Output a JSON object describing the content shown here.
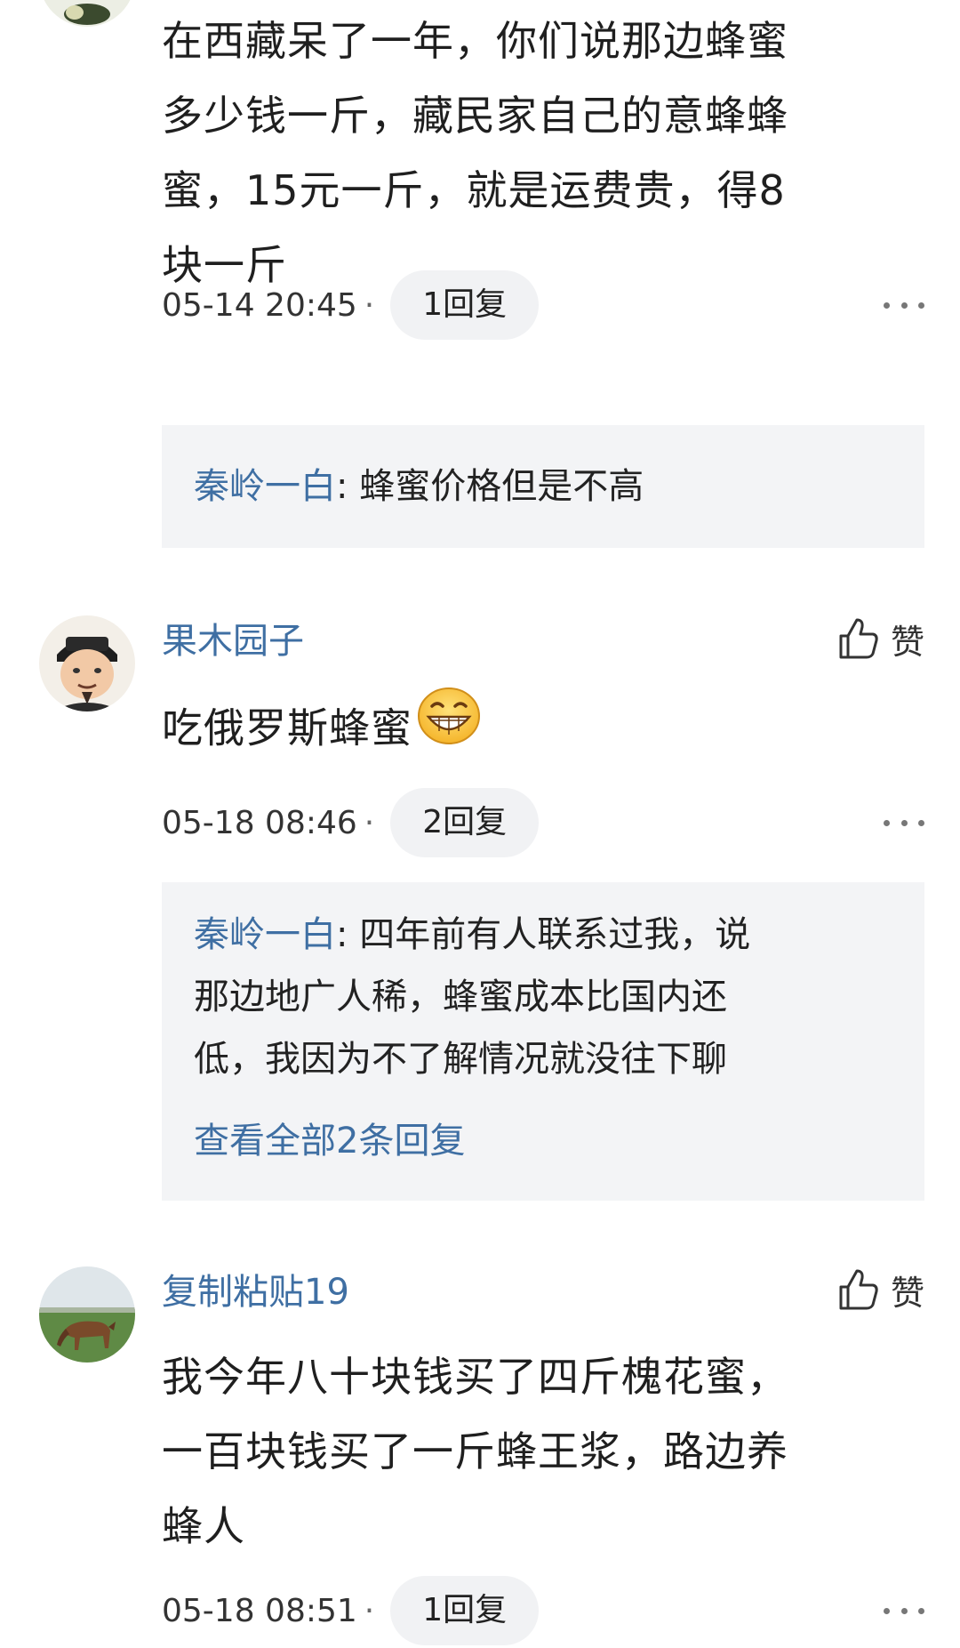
{
  "comments": [
    {
      "content_lines": [
        "在西藏呆了一年，你们说那边蜂蜜",
        "多少钱一斤，藏民家自己的意蜂蜂",
        "蜜，15元一斤，就是运费贵，得8",
        "块一斤"
      ],
      "time": "05-14 20:45",
      "dot": "·",
      "reply_count": "1回复",
      "replies": [
        {
          "user": "秦岭一白",
          "sep": ": ",
          "text": "蜂蜜价格但是不高"
        }
      ]
    },
    {
      "user": "果木园子",
      "like_label": "赞",
      "content": "吃俄罗斯蜂蜜",
      "emoji": "grinning-face-icon",
      "time": "05-18 08:46",
      "dot": "·",
      "reply_count": "2回复",
      "replies": [
        {
          "user": "秦岭一白",
          "sep": ": ",
          "text_lines": [
            "四年前有人联系过我，说",
            "那边地广人稀，蜂蜜成本比国内还",
            "低，我因为不了解情况就没往下聊"
          ]
        }
      ],
      "view_all": "查看全部2条回复"
    },
    {
      "user": "复制粘贴19",
      "like_label": "赞",
      "content_lines": [
        "我今年八十块钱买了四斤槐花蜜，",
        "一百块钱买了一斤蜂王浆，路边养",
        "蜂人"
      ],
      "time": "05-18 08:51",
      "dot": "·",
      "reply_count": "1回复"
    }
  ],
  "colors": {
    "username": "#3f6fa3",
    "reply_bg": "#f3f4f6",
    "pill_bg": "#f1f2f4"
  }
}
